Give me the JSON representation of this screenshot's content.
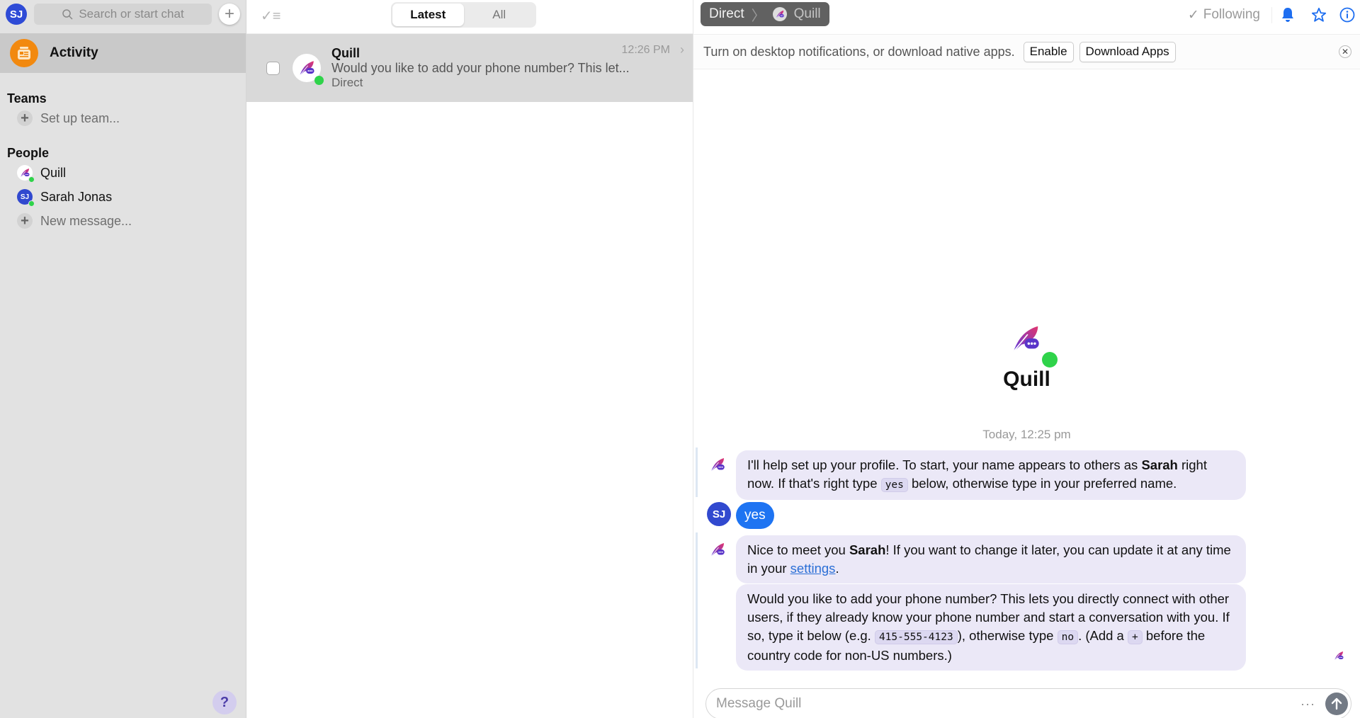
{
  "sidebar": {
    "user_initials": "SJ",
    "search_placeholder": "Search or start chat",
    "activity_label": "Activity",
    "teams_heading": "Teams",
    "teams_items": [
      {
        "label": "Set up team...",
        "icon": "plus-icon"
      }
    ],
    "people_heading": "People",
    "people": [
      {
        "label": "Quill",
        "avatar": "quill-icon",
        "online": true
      },
      {
        "label": "Sarah Jonas",
        "avatar": "SJ",
        "online": true
      }
    ],
    "new_message_label": "New message...",
    "help_label": "?"
  },
  "middle": {
    "tabs": [
      {
        "label": "Latest",
        "active": true
      },
      {
        "label": "All",
        "active": false
      }
    ],
    "conversations": [
      {
        "name": "Quill",
        "preview": "Would you like to add your phone number? This let...",
        "subtitle": "Direct",
        "time": "12:26 PM",
        "online": true
      }
    ]
  },
  "chat": {
    "breadcrumb": {
      "root": "Direct",
      "current": "Quill"
    },
    "following_label": "Following",
    "notification": {
      "text": "Turn on desktop notifications, or download native apps.",
      "enable_label": "Enable",
      "download_label": "Download Apps"
    },
    "hero_name": "Quill",
    "day_stamp": "Today, 12:25 pm",
    "messages": [
      {
        "from": "Quill",
        "parts": [
          "I'll help set up your profile. To start, your name appears to others as ",
          "Sarah",
          " right now. If that's right type ",
          "yes",
          " below, otherwise type in your preferred name."
        ]
      },
      {
        "from": "SJ",
        "text": "yes"
      },
      {
        "from": "Quill",
        "parts": [
          "Nice to meet you ",
          "Sarah",
          "! If you want to change it later, you can update it at any time in your ",
          "settings",
          "."
        ]
      },
      {
        "from": "Quill",
        "parts": [
          "Would you like to add your phone number? This lets you directly connect with other users, if they already know your phone number and start a conversation with you. If so, type it below (e.g. ",
          "415-555-4123",
          "), otherwise type ",
          "no",
          ". (Add a ",
          "+",
          " before the country code for non-US numbers.)"
        ]
      }
    ],
    "composer_placeholder": "Message Quill",
    "more_label": "···"
  },
  "colors": {
    "accent": "#1e74f2",
    "online": "#2fd34a",
    "activity": "#f2890f",
    "bot_bubble": "#ebe8f7"
  }
}
